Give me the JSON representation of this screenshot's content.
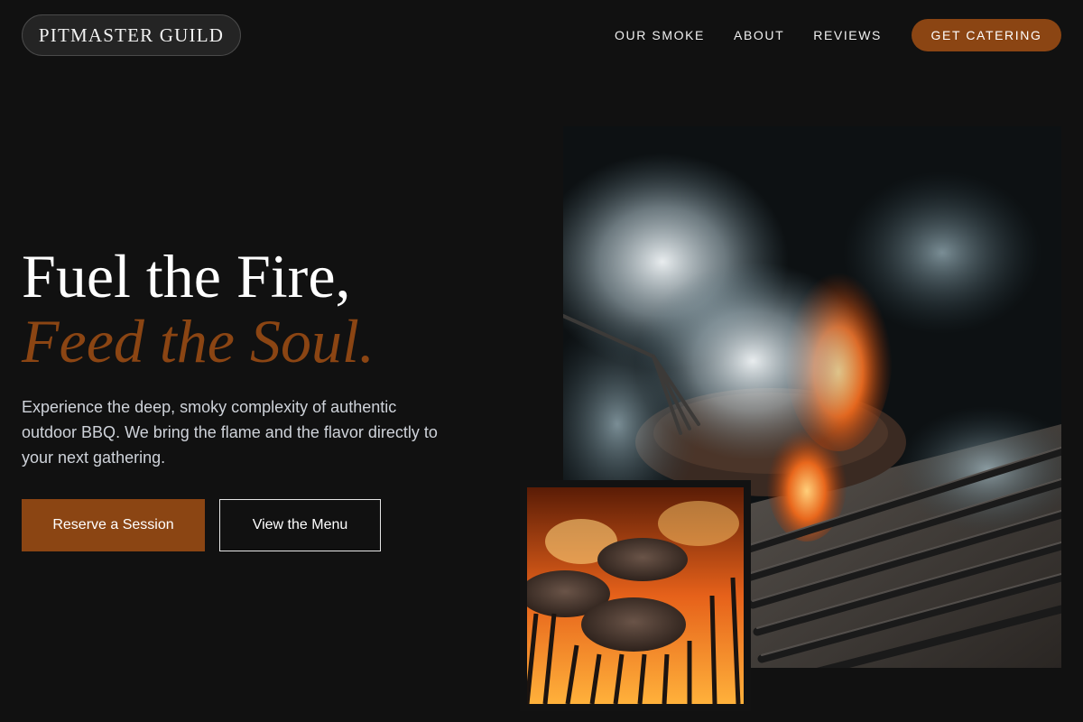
{
  "brand": {
    "name": "PITMASTER GUILD"
  },
  "nav": {
    "links": [
      "OUR SMOKE",
      "ABOUT",
      "REVIEWS"
    ],
    "cta": "GET CATERING"
  },
  "hero": {
    "title_line1": "Fuel the Fire,",
    "title_line2": "Feed the Soul.",
    "description": "Experience the deep, smoky complexity of authentic outdoor BBQ. We bring the flame and the flavor directly to your next gathering.",
    "primary_button": "Reserve a Session",
    "secondary_button": "View the Menu"
  },
  "colors": {
    "background": "#111111",
    "accent": "#8b4513",
    "text": "#ffffff",
    "muted_text": "#cfd3da"
  }
}
